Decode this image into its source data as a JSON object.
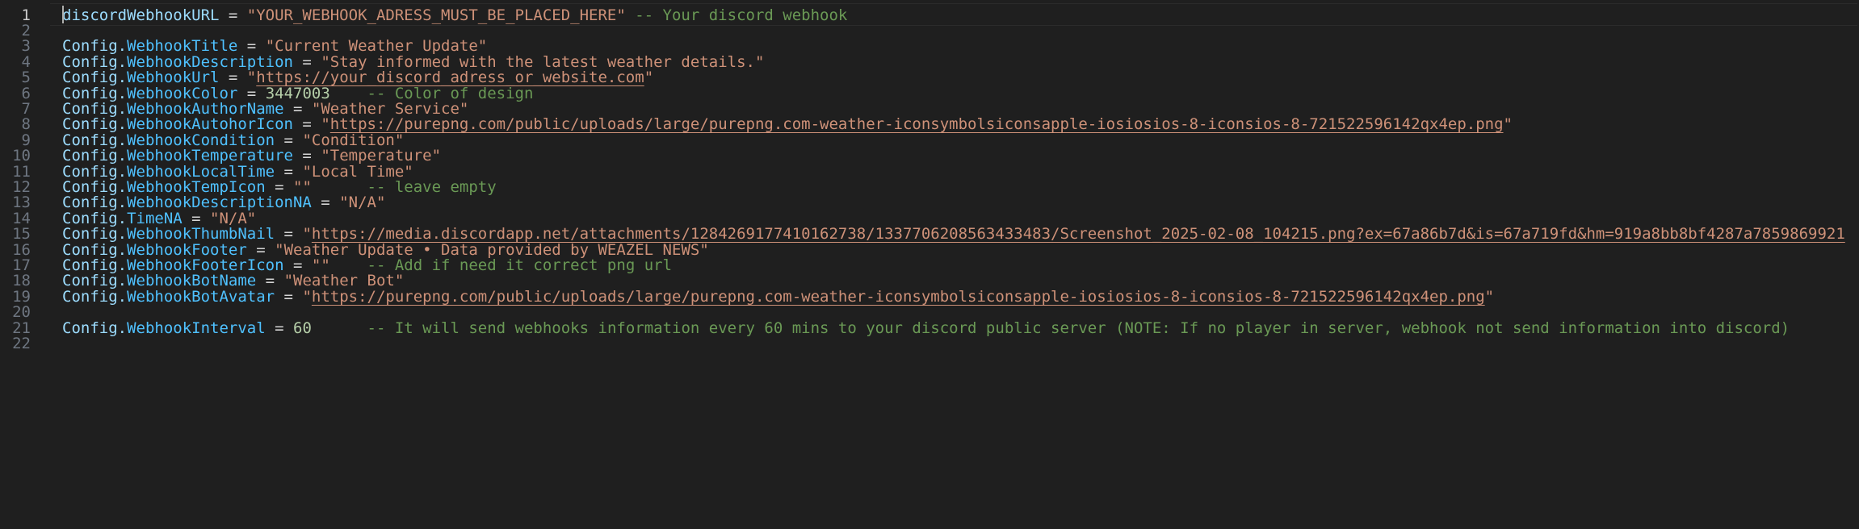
{
  "editor": {
    "current_line": 1,
    "lines": [
      {
        "num": "1",
        "var": "discordWebhookURL",
        "eq": " = ",
        "str": "\"YOUR_WEBHOOK_ADRESS_MUST_BE_PLACED_HERE\"",
        "cmt": " -- Your discord webhook"
      },
      {
        "num": "2"
      },
      {
        "num": "3",
        "obj": "Config.",
        "prop": "WebhookTitle",
        "eq": " = ",
        "str": "\"Current Weather Update\""
      },
      {
        "num": "4",
        "obj": "Config.",
        "prop": "WebhookDescription",
        "eq": " = ",
        "str": "\"Stay informed with the latest weather details.\""
      },
      {
        "num": "5",
        "obj": "Config.",
        "prop": "WebhookUrl",
        "eq": " = ",
        "q1": "\"",
        "url": "https://your_discord_adress_or_website.com",
        "q2": "\""
      },
      {
        "num": "6",
        "obj": "Config.",
        "prop": "WebhookColor",
        "eq": " = ",
        "numval": "3447003",
        "cmt": "    -- Color of design"
      },
      {
        "num": "7",
        "obj": "Config.",
        "prop": "WebhookAuthorName",
        "eq": " = ",
        "str": "\"Weather Service\""
      },
      {
        "num": "8",
        "obj": "Config.",
        "prop": "WebhookAutohorIcon",
        "eq": " = ",
        "q1": "\"",
        "url": "https://purepng.com/public/uploads/large/purepng.com-weather-iconsymbolsiconsapple-iosiosios-8-iconsios-8-721522596142qx4ep.png",
        "q2": "\""
      },
      {
        "num": "9",
        "obj": "Config.",
        "prop": "WebhookCondition",
        "eq": " = ",
        "str": "\"Condition\""
      },
      {
        "num": "10",
        "obj": "Config.",
        "prop": "WebhookTemperature",
        "eq": " = ",
        "str": "\"Temperature\""
      },
      {
        "num": "11",
        "obj": "Config.",
        "prop": "WebhookLocalTime",
        "eq": " = ",
        "str": "\"Local Time\""
      },
      {
        "num": "12",
        "obj": "Config.",
        "prop": "WebhookTempIcon",
        "eq": " = ",
        "str": "\"\"",
        "cmt": "      -- leave empty"
      },
      {
        "num": "13",
        "obj": "Config.",
        "prop": "WebhookDescriptionNA",
        "eq": " = ",
        "str": "\"N/A\""
      },
      {
        "num": "14",
        "obj": "Config.",
        "prop": "TimeNA",
        "eq": " = ",
        "str": "\"N/A\""
      },
      {
        "num": "15",
        "obj": "Config.",
        "prop": "WebhookThumbNail",
        "eq": " = ",
        "q1": "\"",
        "url": "https://media.discordapp.net/attachments/1284269177410162738/1337706208563433483/Screenshot_2025-02-08_104215.png?ex=67a86b7d&is=67a719fd&hm=919a8bb8bf4287a7859869921"
      },
      {
        "num": "16",
        "obj": "Config.",
        "prop": "WebhookFooter",
        "eq": " = ",
        "str": "\"Weather Update • Data provided by WEAZEL NEWS\""
      },
      {
        "num": "17",
        "obj": "Config.",
        "prop": "WebhookFooterIcon",
        "eq": " = ",
        "str": "\"\"",
        "cmt": "    -- Add if need it correct png url"
      },
      {
        "num": "18",
        "obj": "Config.",
        "prop": "WebhookBotName",
        "eq": " = ",
        "str": "\"Weather Bot\""
      },
      {
        "num": "19",
        "obj": "Config.",
        "prop": "WebhookBotAvatar",
        "eq": " = ",
        "q1": "\"",
        "url": "https://purepng.com/public/uploads/large/purepng.com-weather-iconsymbolsiconsapple-iosiosios-8-iconsios-8-721522596142qx4ep.png",
        "q2": "\""
      },
      {
        "num": "20"
      },
      {
        "num": "21",
        "obj": "Config.",
        "prop": "WebhookInterval",
        "eq": " = ",
        "numval": "60",
        "cmt": "      -- It will send webhooks information every 60 mins to your discord public server (NOTE: If no player in server, webhook not send information into discord)"
      },
      {
        "num": "22"
      }
    ]
  }
}
